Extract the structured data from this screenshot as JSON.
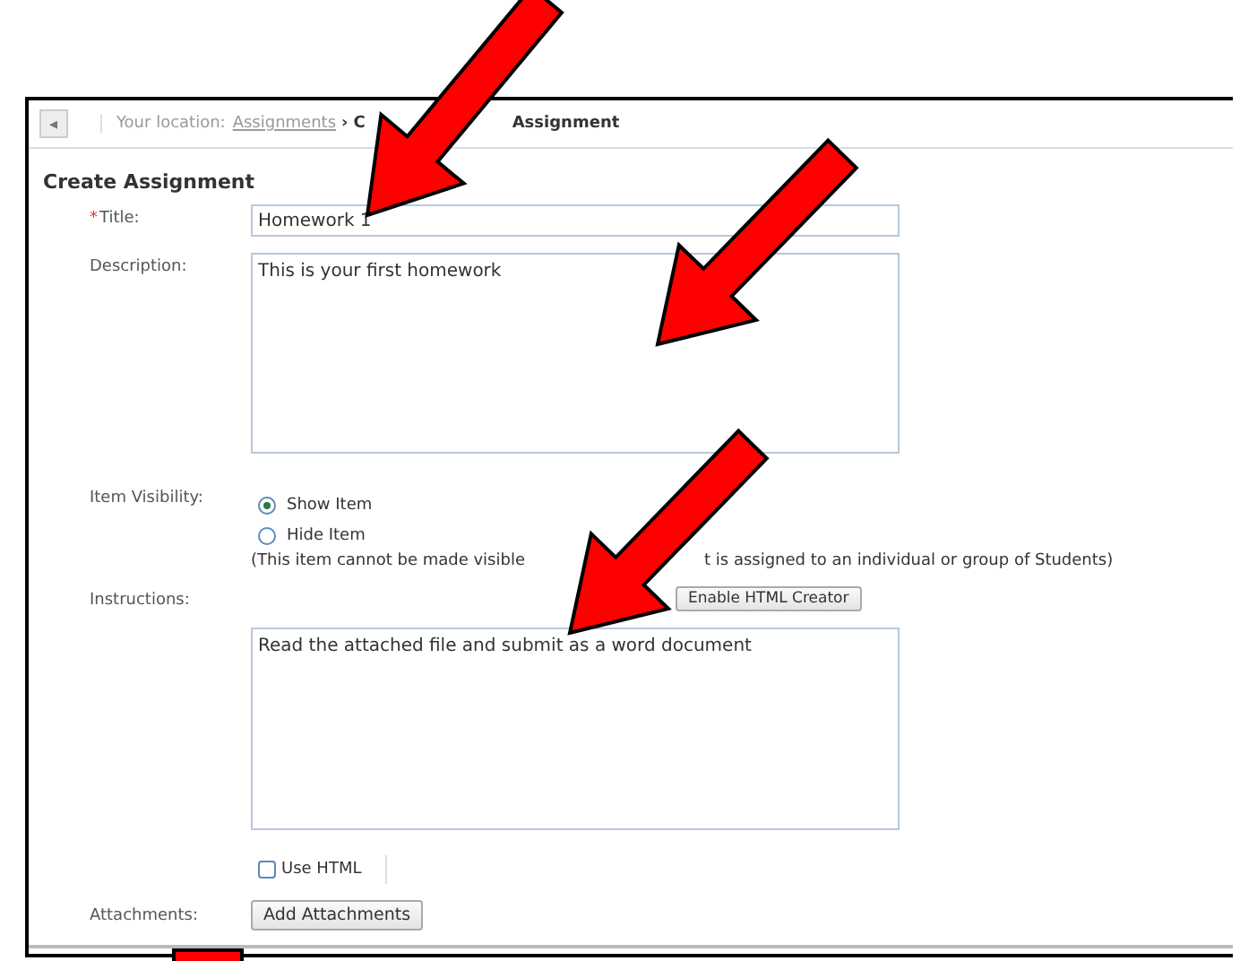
{
  "breadcrumb": {
    "back": "◂",
    "label": "Your location:",
    "link": "Assignments",
    "separator": "›",
    "current_parts": [
      "C",
      "Assignment"
    ]
  },
  "heading": "Create Assignment",
  "title_field": {
    "required_mark": "*",
    "label": "Title:",
    "value": "Homework 1"
  },
  "description_field": {
    "label": "Description:",
    "value": "This is your first homework"
  },
  "visibility": {
    "label": "Item Visibility:",
    "options": [
      {
        "label": "Show Item",
        "selected": true
      },
      {
        "label": "Hide Item",
        "selected": false
      }
    ],
    "note_parts": [
      "(This item cannot be made visible",
      "t is assigned to an individual or group of Students)"
    ]
  },
  "instructions": {
    "label": "Instructions:",
    "button": "Enable HTML Creator",
    "value": "Read the attached file and submit as a word document"
  },
  "use_html": {
    "label": "Use HTML",
    "checked": false
  },
  "attachments": {
    "label": "Attachments:",
    "button": "Add Attachments"
  }
}
